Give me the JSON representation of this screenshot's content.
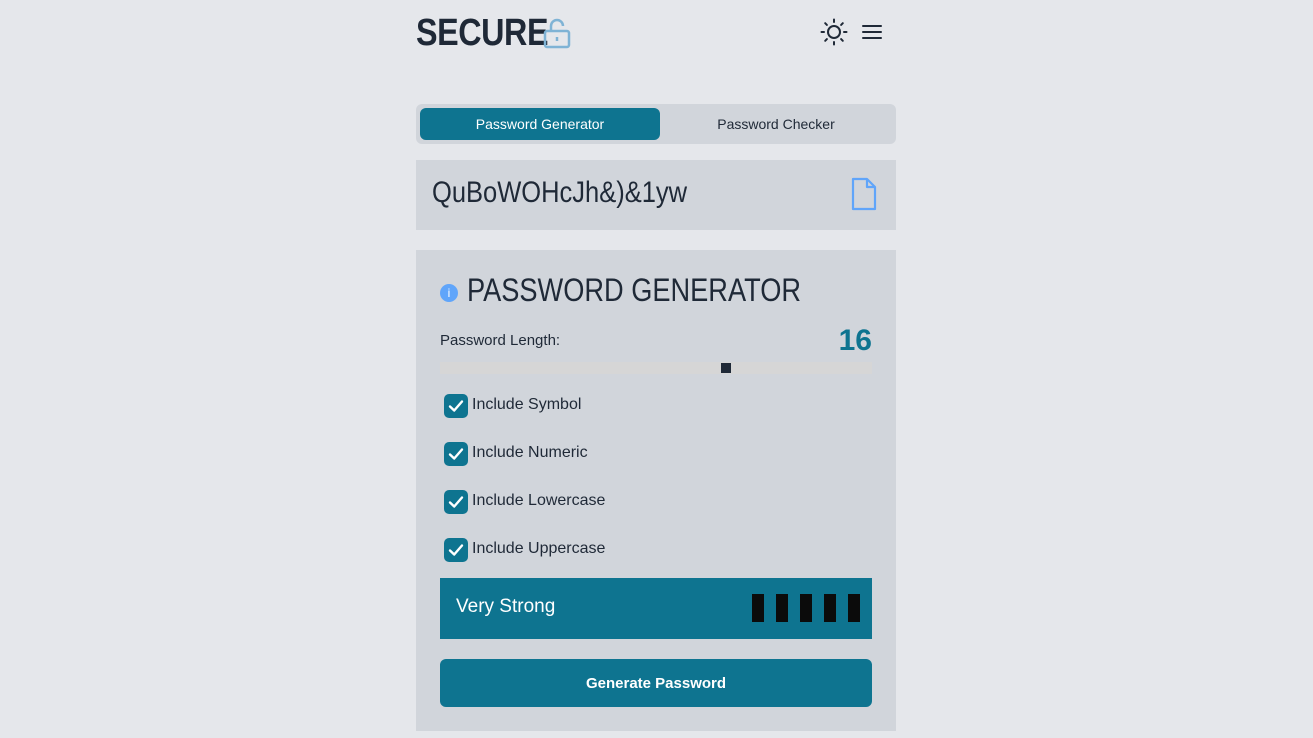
{
  "brand": {
    "name": "SECURE",
    "lock_icon": "unlock-icon"
  },
  "header": {
    "theme_icon": "sun-icon",
    "menu_icon": "hamburger-menu-icon"
  },
  "tabs": [
    {
      "label": "Password Generator",
      "active": true
    },
    {
      "label": "Password Checker",
      "active": false
    }
  ],
  "output": {
    "password": "QuBoWOHcJh&)&1yw",
    "copy_icon": "copy-document-icon"
  },
  "generator": {
    "title": "PASSWORD GENERATOR",
    "info_icon": "info-icon",
    "info_glyph": "i",
    "length_label": "Password Length:",
    "length_value": "16",
    "slider_fraction": 0.663,
    "options": [
      {
        "label": "Include Symbol",
        "checked": true
      },
      {
        "label": "Include Numeric",
        "checked": true
      },
      {
        "label": "Include Lowercase",
        "checked": true
      },
      {
        "label": "Include Uppercase",
        "checked": true
      }
    ],
    "strength_label": "Very Strong",
    "strength_bars_filled": 5,
    "strength_bars_total": 5,
    "generate_label": "Generate Password"
  },
  "colors": {
    "accent": "#0e7490",
    "background": "#e5e7eb",
    "panel": "#d1d5db",
    "info": "#60a5fa"
  }
}
